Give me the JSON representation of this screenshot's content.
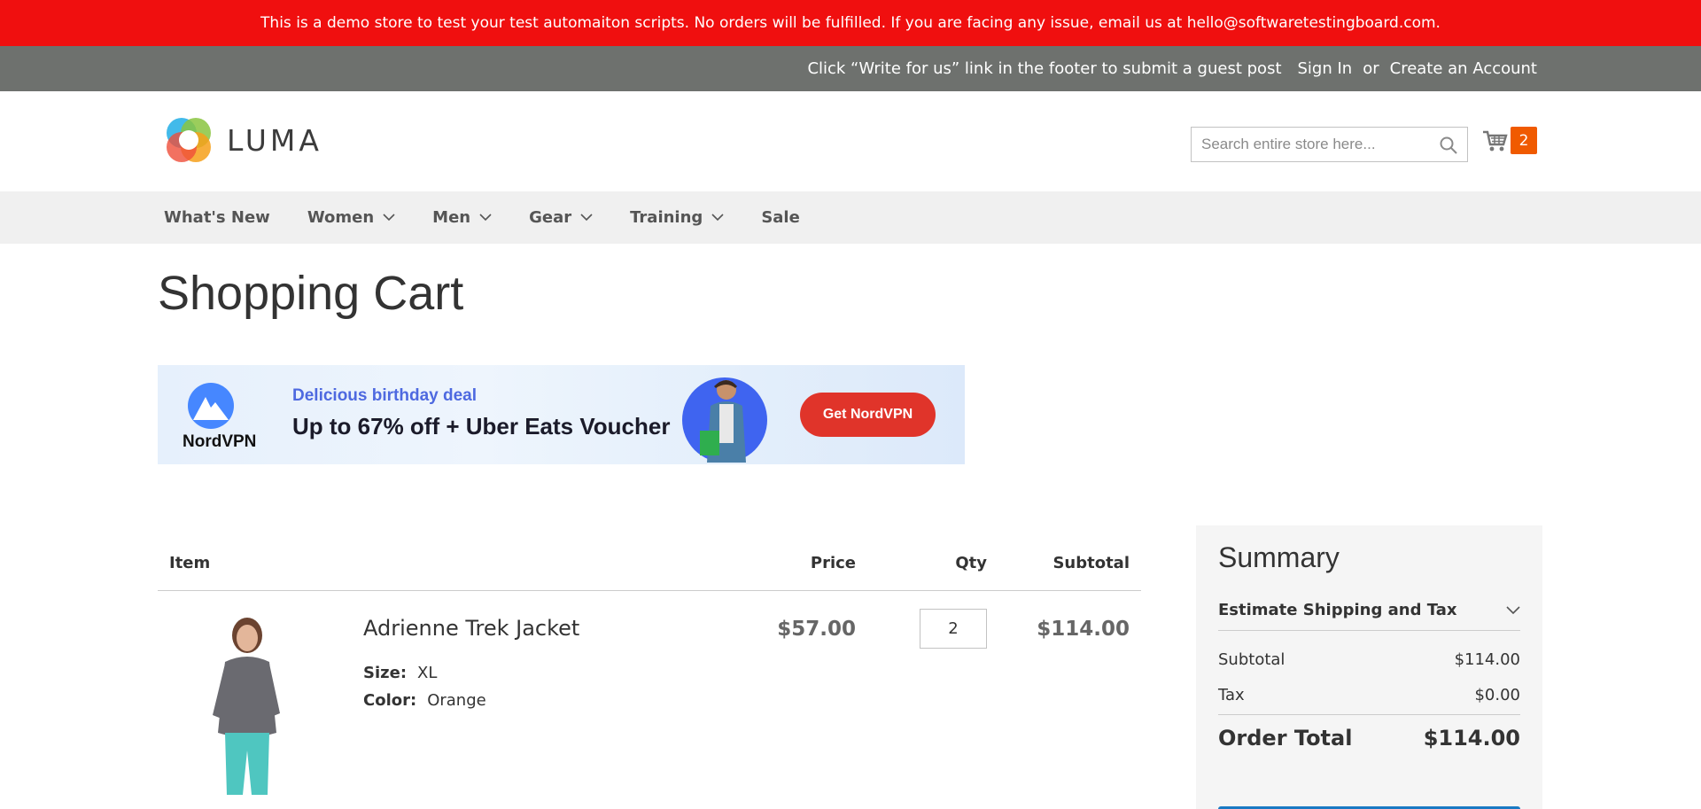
{
  "demo_notice": "This is a demo store to test your test automaiton scripts. No orders will be fulfilled. If you are facing any issue, email us at hello@softwaretestingboard.com.",
  "top_links": {
    "guest_post": "Click “Write for us” link in the footer to submit a guest post",
    "sign_in": "Sign In",
    "or": "or",
    "create_account": "Create an Account"
  },
  "logo": {
    "text": "LUMA"
  },
  "search": {
    "placeholder": "Search entire store here..."
  },
  "minicart": {
    "count": "2"
  },
  "nav": {
    "items": [
      {
        "label": "What's New",
        "has_submenu": false
      },
      {
        "label": "Women",
        "has_submenu": true
      },
      {
        "label": "Men",
        "has_submenu": true
      },
      {
        "label": "Gear",
        "has_submenu": true
      },
      {
        "label": "Training",
        "has_submenu": true
      },
      {
        "label": "Sale",
        "has_submenu": false
      }
    ]
  },
  "page_title": "Shopping Cart",
  "banner": {
    "brand": "NordVPN",
    "deal": "Delicious birthday deal",
    "offer": "Up to 67% off + Uber Eats Voucher",
    "cta": "Get NordVPN"
  },
  "cart_table": {
    "headers": {
      "item": "Item",
      "price": "Price",
      "qty": "Qty",
      "subtotal": "Subtotal"
    },
    "items": [
      {
        "name": "Adrienne Trek Jacket",
        "options": [
          {
            "label": "Size:",
            "value": "XL"
          },
          {
            "label": "Color:",
            "value": "Orange"
          }
        ],
        "price": "$57.00",
        "qty": "2",
        "subtotal": "$114.00"
      }
    ]
  },
  "summary": {
    "title": "Summary",
    "estimate": "Estimate Shipping and Tax",
    "subtotal_label": "Subtotal",
    "subtotal_value": "$114.00",
    "tax_label": "Tax",
    "tax_value": "$0.00",
    "total_label": "Order Total",
    "total_value": "$114.00"
  },
  "colors": {
    "demo_bar": "#f00f0f",
    "top_bar": "#6e716e",
    "nav_bg": "#f0f0f0",
    "cart_badge": "#f05a00",
    "cta": "#e0342a",
    "checkout": "#1979c3"
  }
}
